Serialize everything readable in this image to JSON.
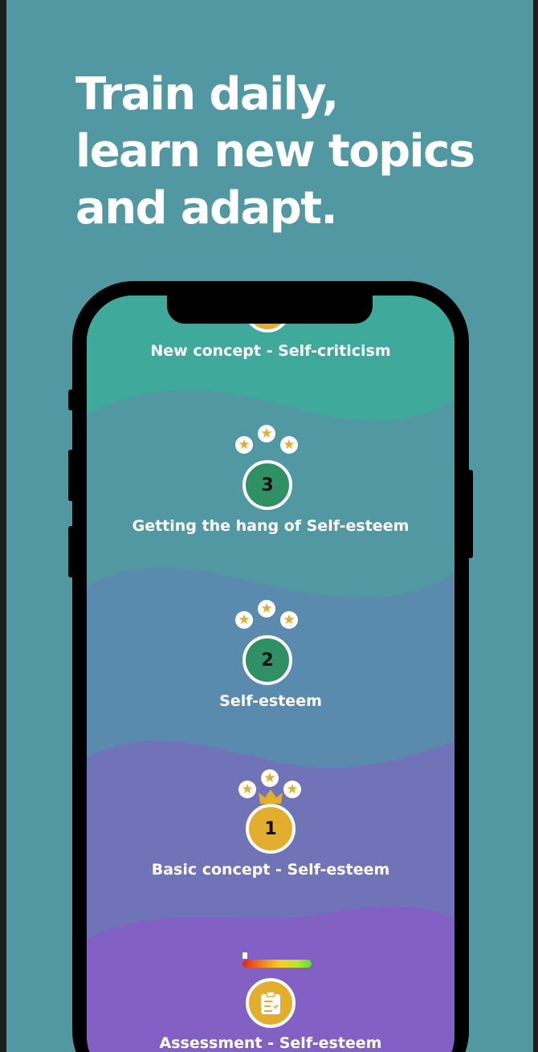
{
  "headline": {
    "line1": "Train daily,",
    "line2": "learn new topics",
    "line3": "and adapt."
  },
  "levels": [
    {
      "label": "New concept - Self-criticism",
      "badge": ""
    },
    {
      "label": "Getting the hang of Self-esteem",
      "badge": "3",
      "stars": 3
    },
    {
      "label": "Self-esteem",
      "badge": "2",
      "stars": 3
    },
    {
      "label": "Basic concept - Self-esteem",
      "badge": "1",
      "stars": 3,
      "crown": true
    },
    {
      "label": "Assessment - Self-esteem",
      "badge_icon": "clipboard-check-icon",
      "meter_level": 0.05
    }
  ],
  "colors": {
    "background": "#5198a3",
    "band_teal": "#3fa99b",
    "band_blue": "#5a8aad",
    "band_lavender": "#7173b9",
    "band_purple": "#8360c4",
    "node_green": "#2f9066",
    "node_gold": "#e3ad2d"
  }
}
